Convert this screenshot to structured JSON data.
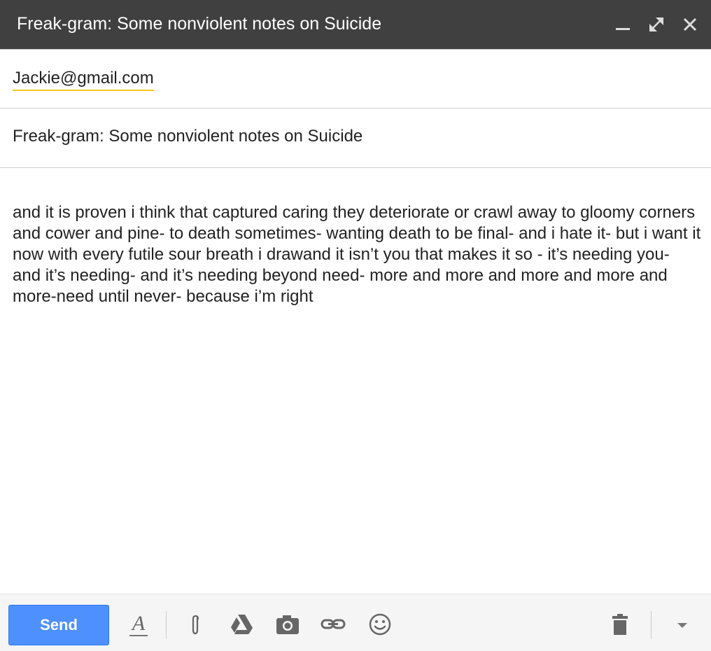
{
  "window": {
    "title": "Freak-gram: Some nonviolent notes on Suicide"
  },
  "to": {
    "recipient": "Jackie@gmail.com"
  },
  "subject": {
    "value": "Freak-gram: Some nonviolent notes on Suicide"
  },
  "body": {
    "text": "and it is proven i think that captured caring they deteriorate or crawl away to gloomy corners and cower and pine- to death sometimes- wanting death to be final- and i hate it- but i want it now with every futile sour breath i drawand it isn’t you that makes it so - it’s needing you- and it’s needing- and it’s needing beyond need- more and more and more and more and more-need until never- because i’m right"
  },
  "toolbar": {
    "send_label": "Send",
    "icons": [
      "format-text-icon",
      "attach-icon",
      "drive-icon",
      "photo-icon",
      "link-icon",
      "emoji-icon",
      "trash-icon",
      "more-options-icon"
    ]
  },
  "colors": {
    "titlebar": "#404040",
    "send_button": "#4d90fe",
    "recipient_underline": "#f5c518"
  }
}
